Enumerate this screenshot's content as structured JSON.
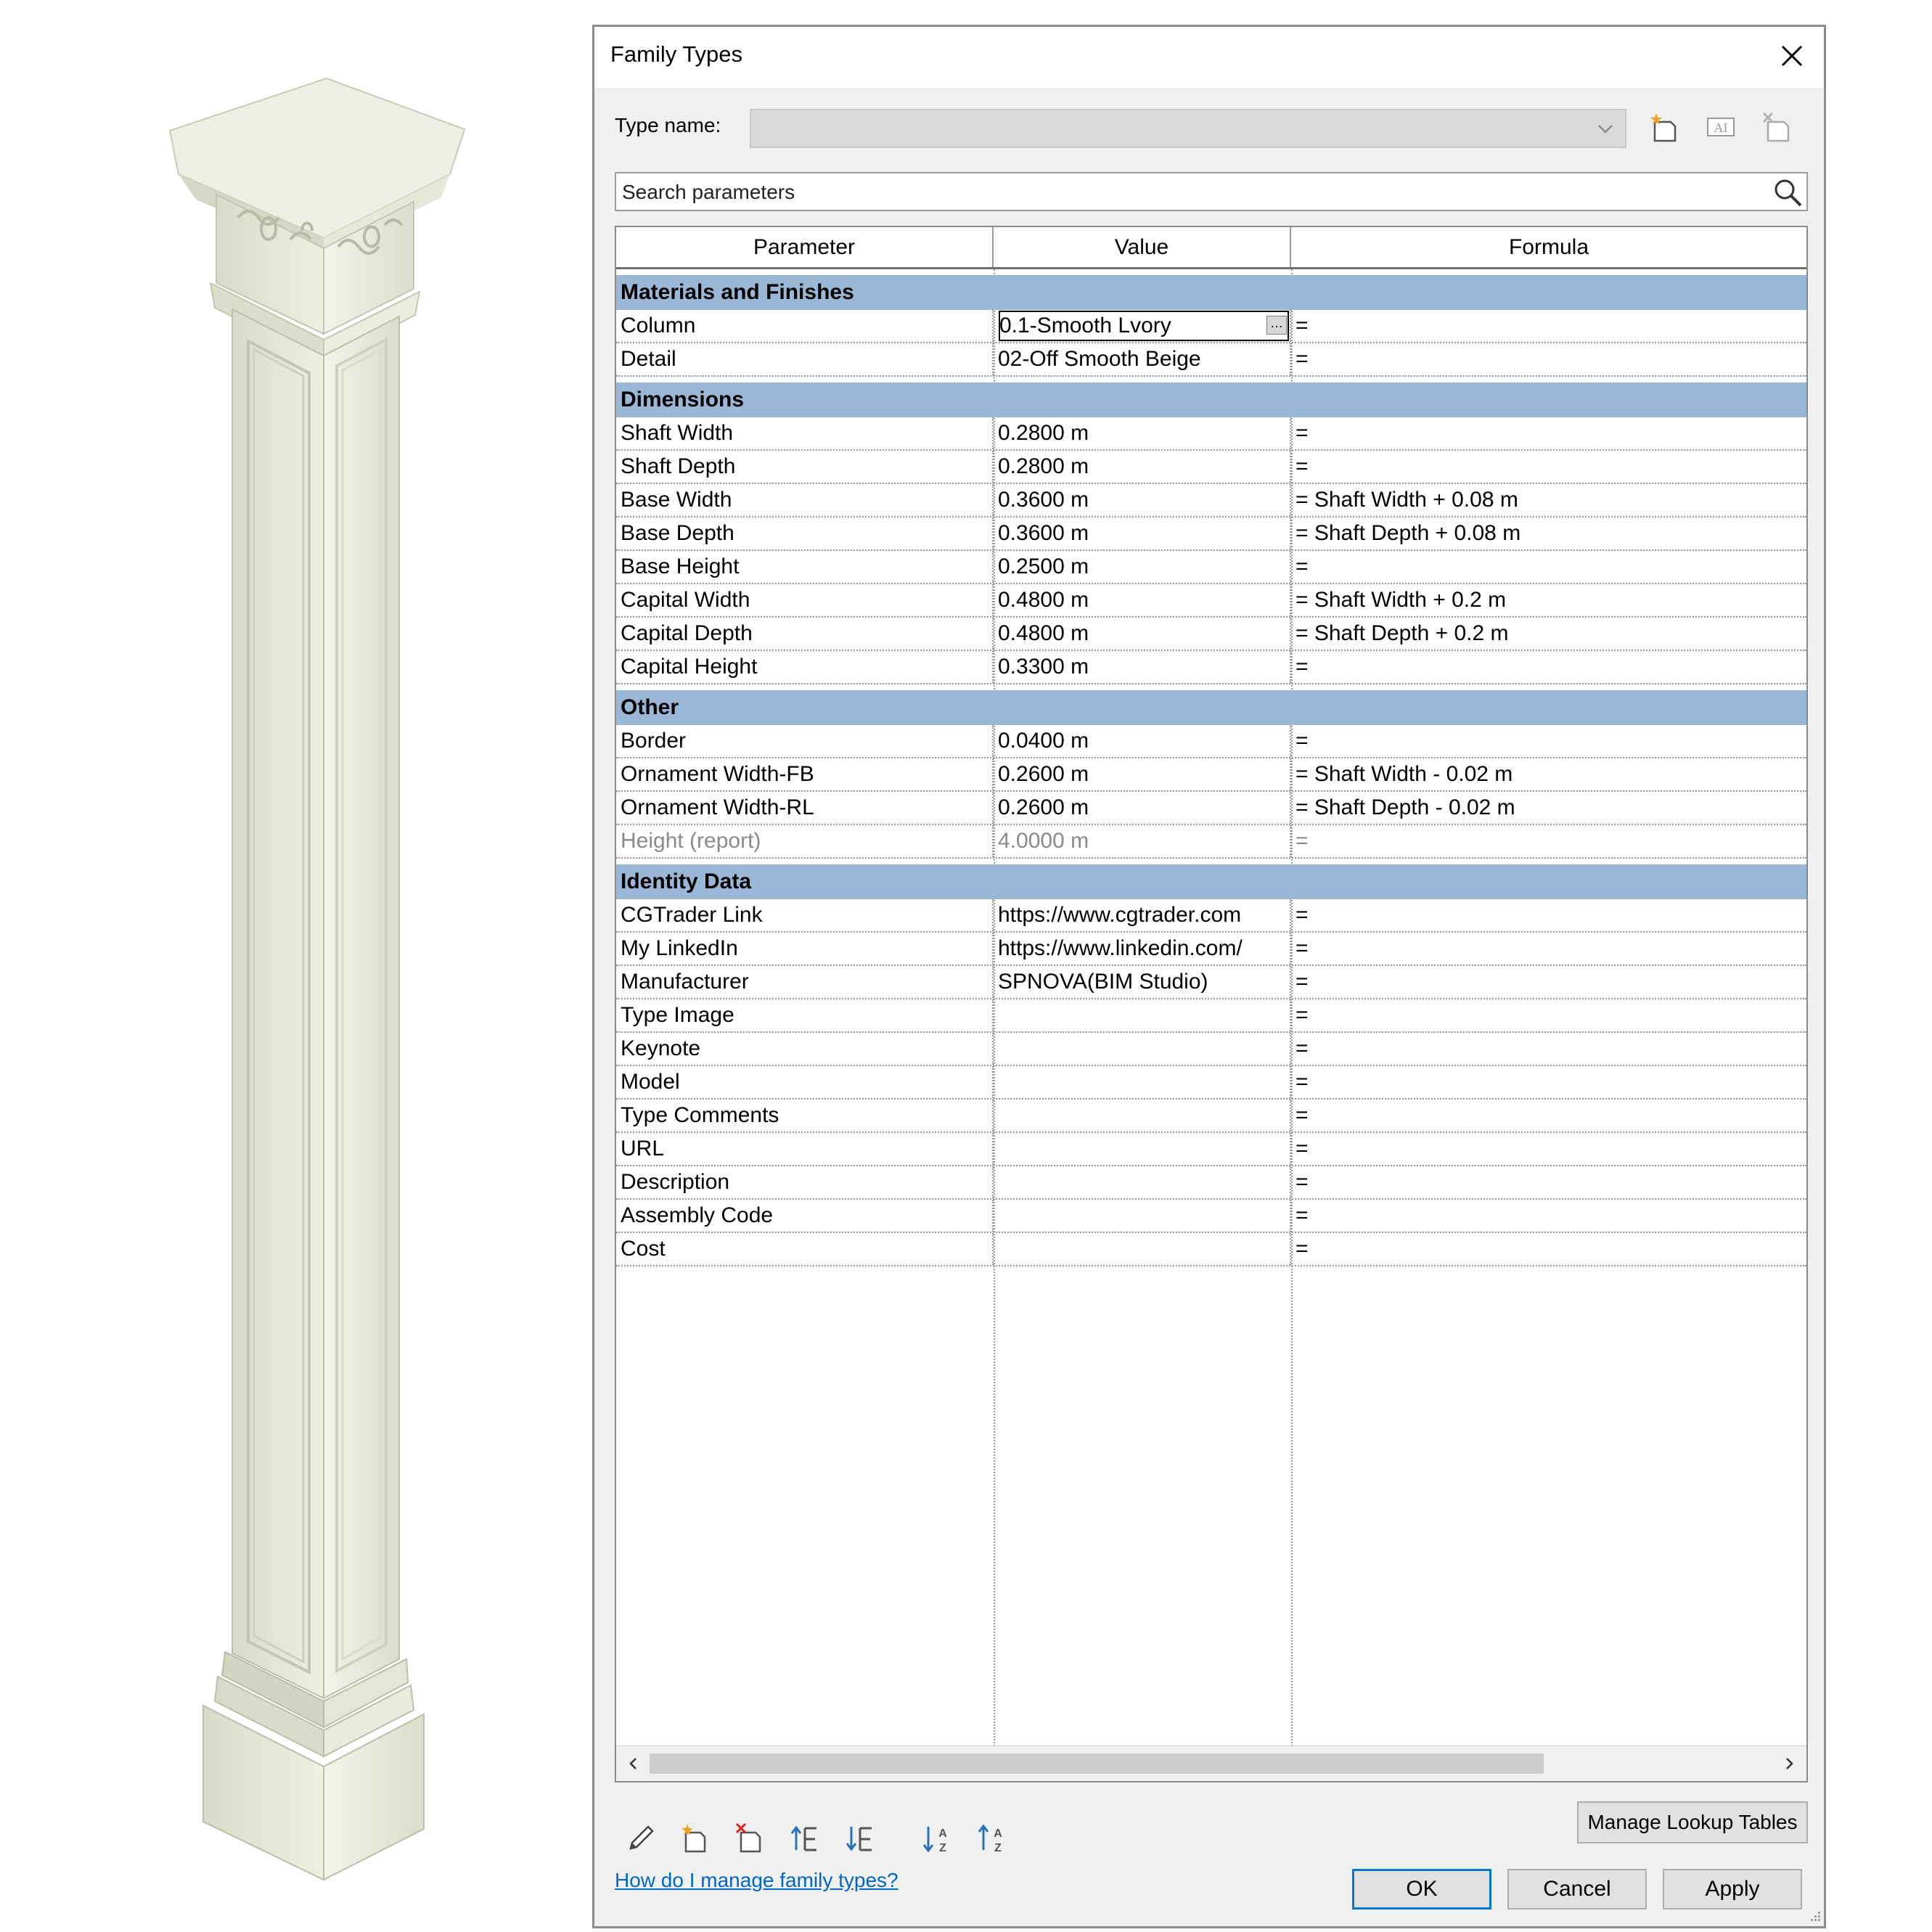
{
  "dialog": {
    "title": "Family Types",
    "type_name_label": "Type name:",
    "type_name_value": "",
    "search_placeholder": "Search parameters"
  },
  "table": {
    "headers": {
      "parameter": "Parameter",
      "value": "Value",
      "formula": "Formula"
    },
    "groups": [
      {
        "name": "Materials and Finishes",
        "rows": [
          {
            "parameter": "Column",
            "value": "0.1-Smooth Lvory",
            "formula": "=",
            "selected": true
          },
          {
            "parameter": "Detail",
            "value": "02-Off Smooth Beige",
            "formula": "="
          }
        ]
      },
      {
        "name": "Dimensions",
        "rows": [
          {
            "parameter": "Shaft Width",
            "value": "0.2800 m",
            "formula": "="
          },
          {
            "parameter": "Shaft Depth",
            "value": "0.2800 m",
            "formula": "="
          },
          {
            "parameter": "Base Width",
            "value": "0.3600 m",
            "formula": "= Shaft Width + 0.08 m"
          },
          {
            "parameter": "Base Depth",
            "value": "0.3600 m",
            "formula": "= Shaft Depth + 0.08 m"
          },
          {
            "parameter": "Base Height",
            "value": "0.2500 m",
            "formula": "="
          },
          {
            "parameter": "Capital Width",
            "value": "0.4800 m",
            "formula": "= Shaft Width + 0.2 m"
          },
          {
            "parameter": "Capital Depth",
            "value": "0.4800 m",
            "formula": "= Shaft Depth + 0.2 m"
          },
          {
            "parameter": "Capital Height",
            "value": "0.3300 m",
            "formula": "="
          }
        ]
      },
      {
        "name": "Other",
        "rows": [
          {
            "parameter": "Border",
            "value": "0.0400 m",
            "formula": "="
          },
          {
            "parameter": "Ornament Width-FB",
            "value": "0.2600 m",
            "formula": "= Shaft Width - 0.02 m"
          },
          {
            "parameter": "Ornament Width-RL",
            "value": "0.2600 m",
            "formula": "= Shaft Depth - 0.02 m"
          },
          {
            "parameter": "Height (report)",
            "value": "4.0000 m",
            "formula": "=",
            "disabled": true
          }
        ]
      },
      {
        "name": "Identity Data",
        "rows": [
          {
            "parameter": "CGTrader Link",
            "value": "https://www.cgtrader.com",
            "formula": "="
          },
          {
            "parameter": "My LinkedIn",
            "value": "https://www.linkedin.com/",
            "formula": "="
          },
          {
            "parameter": "Manufacturer",
            "value": "SPNOVA(BIM Studio)",
            "formula": "="
          },
          {
            "parameter": "Type Image",
            "value": "",
            "formula": "="
          },
          {
            "parameter": "Keynote",
            "value": "",
            "formula": "="
          },
          {
            "parameter": "Model",
            "value": "",
            "formula": "="
          },
          {
            "parameter": "Type Comments",
            "value": "",
            "formula": "="
          },
          {
            "parameter": "URL",
            "value": "",
            "formula": "="
          },
          {
            "parameter": "Description",
            "value": "",
            "formula": "="
          },
          {
            "parameter": "Assembly Code",
            "value": "",
            "formula": "="
          },
          {
            "parameter": "Cost",
            "value": "",
            "formula": "="
          }
        ]
      }
    ]
  },
  "toolbar": {
    "icons": [
      "pencil-icon",
      "new-parameter-icon",
      "delete-parameter-icon",
      "move-up-icon",
      "move-down-icon",
      "sort-ascending-icon",
      "sort-descending-icon"
    ],
    "manage_lookup_label": "Manage Lookup Tables"
  },
  "footer": {
    "help_link": "How do I manage family types?",
    "ok_label": "OK",
    "cancel_label": "Cancel",
    "apply_label": "Apply"
  },
  "colors": {
    "group_header": "#9bb7d6",
    "link": "#0066cc",
    "ok_border": "#0078d7",
    "column_color": "#e9ead9"
  }
}
